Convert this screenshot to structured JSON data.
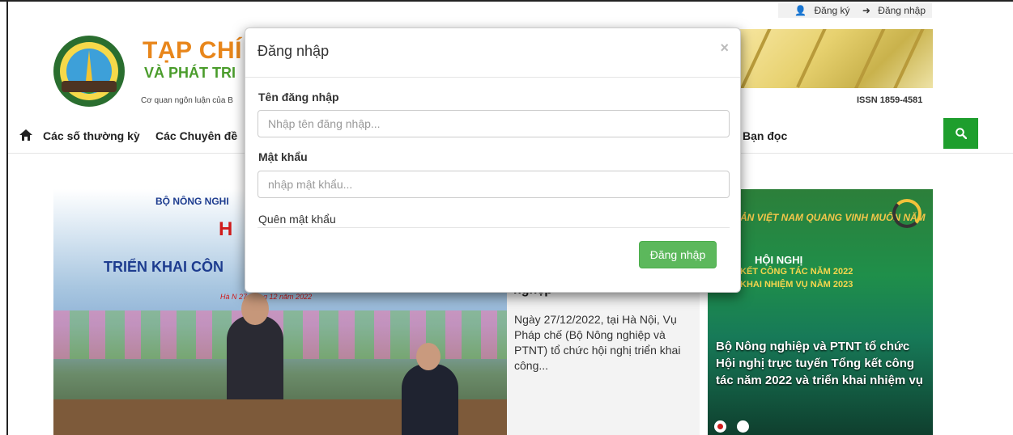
{
  "topbar": {
    "register_label": "Đăng ký",
    "login_label": "Đăng nhập"
  },
  "header": {
    "brand_title": "TẠP CHÍ",
    "brand_subtitle": "VÀ PHÁT TRI",
    "brand_desc": "Cơ quan ngôn luận của B",
    "issn": "ISSN 1859-4581"
  },
  "nav": {
    "items": [
      {
        "label": "Các số thường kỳ"
      },
      {
        "label": "Các Chuyên đề"
      },
      {
        "label": "Bạn đọc"
      }
    ],
    "search_icon": "search-icon",
    "home_icon": "home-icon",
    "accent": "#1e9e2d"
  },
  "hero": {
    "left_image": {
      "line1": "BỘ NÔNG NGHI",
      "line2": "H",
      "line3": "TRIỂN KHAI CÔN",
      "line4": "Hà N        27 tháng 12 năm 2022"
    },
    "middle": {
      "title": "nghệp",
      "description": "Ngày 27/12/2022, tại Hà Nội, Vụ Pháp chế (Bộ Nông nghiệp và PTNT) tổ chức hội nghị triển khai công..."
    },
    "right": {
      "top_text": "ẢN VIỆT NAM QUANG VINH MUÔN NĂM",
      "heading1": "HỘI NGHỊ",
      "heading2": "KẾT CÔNG TÁC NĂM 2022",
      "heading3": "KHAI NHIỆM VỤ NĂM 2023",
      "caption": "Bộ Nông nghiệp và PTNT tổ chức Hội nghị trực tuyến Tổng kết công tác năm 2022 và triển khai nhiệm vụ"
    }
  },
  "modal": {
    "title": "Đăng nhập",
    "close_symbol": "×",
    "username_label": "Tên đăng nhập",
    "username_placeholder": "Nhập tên đăng nhập...",
    "password_label": "Mật khẩu",
    "password_placeholder": "nhập mật khẩu...",
    "forgot_label": "Quên mật khẩu",
    "submit_label": "Đăng nhập",
    "submit_color": "#5cb85c"
  }
}
